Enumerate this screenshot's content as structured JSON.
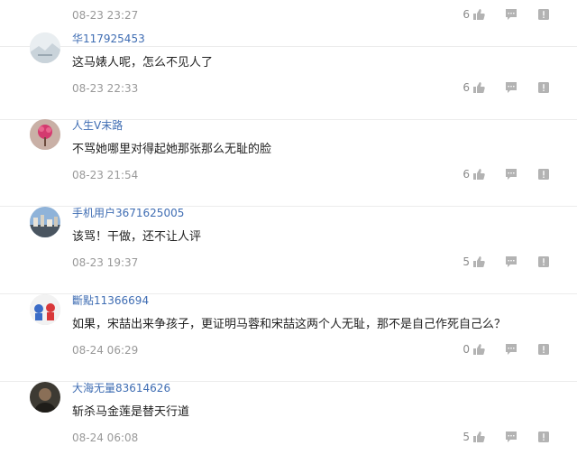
{
  "top_partial": {
    "time": "08-23 23:27",
    "likes": "6"
  },
  "comments": [
    {
      "username": "华117925453",
      "text": "这马婊人呢，怎么不见人了",
      "time": "08-23 22:33",
      "likes": "6",
      "avatar_icon": "landscape-avatar-icon"
    },
    {
      "username": "人生V末路",
      "text": "不骂她哪里对得起她那张那么无耻的脸",
      "time": "08-23 21:54",
      "likes": "6",
      "avatar_icon": "flower-avatar-icon"
    },
    {
      "username": "手机用户3671625005",
      "text": "该骂！干做，还不让人评",
      "time": "08-23 19:37",
      "likes": "5",
      "avatar_icon": "city-avatar-icon"
    },
    {
      "username": "斷點11366694",
      "text": "如果，宋喆出来争孩子，更证明马蓉和宋喆这两个人无耻，那不是自己作死自己么？",
      "time": "08-24 06:29",
      "likes": "0",
      "avatar_icon": "figures-avatar-icon"
    },
    {
      "username": "大海无量83614626",
      "text": "斩杀马金莲是替天行道",
      "time": "08-24 06:08",
      "likes": "5",
      "avatar_icon": "portrait-avatar-icon"
    }
  ],
  "colors": {
    "username": "#3f6db3",
    "meta": "#999999",
    "icon": "#b3b3b3"
  }
}
